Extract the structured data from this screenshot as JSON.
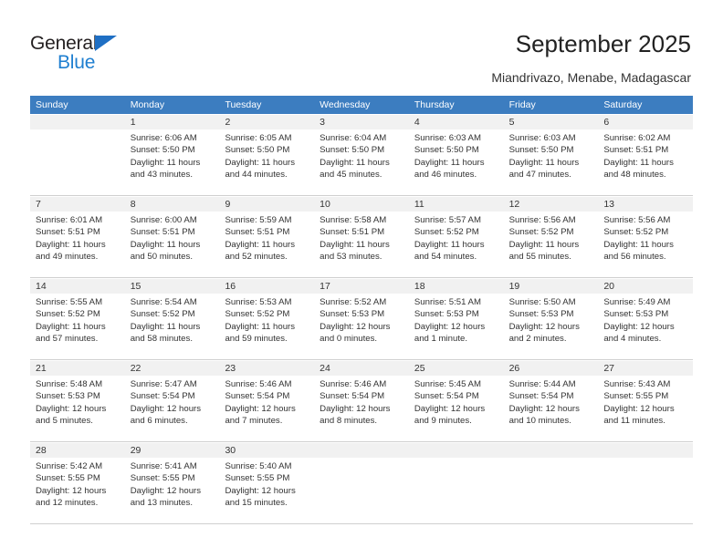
{
  "brand": {
    "name_top": "General",
    "name_bottom": "Blue",
    "triangle_color": "#1f6fc4",
    "blue_text_color": "#1f7fd0"
  },
  "header": {
    "title": "September 2025",
    "subtitle": "Miandrivazo, Menabe, Madagascar"
  },
  "theme": {
    "header_bg": "#3c7dc0",
    "header_text": "#ffffff",
    "datenum_bg": "#f1f1f1",
    "cell_bg": "#ffffff",
    "grid_line": "#cfcfcf",
    "text": "#333333"
  },
  "calendar": {
    "weekdays": [
      "Sunday",
      "Monday",
      "Tuesday",
      "Wednesday",
      "Thursday",
      "Friday",
      "Saturday"
    ],
    "weeks": [
      {
        "days": [
          {
            "num": "",
            "sunrise": "",
            "sunset": "",
            "daylight_1": "",
            "daylight_2": ""
          },
          {
            "num": "1",
            "sunrise": "Sunrise: 6:06 AM",
            "sunset": "Sunset: 5:50 PM",
            "daylight_1": "Daylight: 11 hours",
            "daylight_2": "and 43 minutes."
          },
          {
            "num": "2",
            "sunrise": "Sunrise: 6:05 AM",
            "sunset": "Sunset: 5:50 PM",
            "daylight_1": "Daylight: 11 hours",
            "daylight_2": "and 44 minutes."
          },
          {
            "num": "3",
            "sunrise": "Sunrise: 6:04 AM",
            "sunset": "Sunset: 5:50 PM",
            "daylight_1": "Daylight: 11 hours",
            "daylight_2": "and 45 minutes."
          },
          {
            "num": "4",
            "sunrise": "Sunrise: 6:03 AM",
            "sunset": "Sunset: 5:50 PM",
            "daylight_1": "Daylight: 11 hours",
            "daylight_2": "and 46 minutes."
          },
          {
            "num": "5",
            "sunrise": "Sunrise: 6:03 AM",
            "sunset": "Sunset: 5:50 PM",
            "daylight_1": "Daylight: 11 hours",
            "daylight_2": "and 47 minutes."
          },
          {
            "num": "6",
            "sunrise": "Sunrise: 6:02 AM",
            "sunset": "Sunset: 5:51 PM",
            "daylight_1": "Daylight: 11 hours",
            "daylight_2": "and 48 minutes."
          }
        ]
      },
      {
        "days": [
          {
            "num": "7",
            "sunrise": "Sunrise: 6:01 AM",
            "sunset": "Sunset: 5:51 PM",
            "daylight_1": "Daylight: 11 hours",
            "daylight_2": "and 49 minutes."
          },
          {
            "num": "8",
            "sunrise": "Sunrise: 6:00 AM",
            "sunset": "Sunset: 5:51 PM",
            "daylight_1": "Daylight: 11 hours",
            "daylight_2": "and 50 minutes."
          },
          {
            "num": "9",
            "sunrise": "Sunrise: 5:59 AM",
            "sunset": "Sunset: 5:51 PM",
            "daylight_1": "Daylight: 11 hours",
            "daylight_2": "and 52 minutes."
          },
          {
            "num": "10",
            "sunrise": "Sunrise: 5:58 AM",
            "sunset": "Sunset: 5:51 PM",
            "daylight_1": "Daylight: 11 hours",
            "daylight_2": "and 53 minutes."
          },
          {
            "num": "11",
            "sunrise": "Sunrise: 5:57 AM",
            "sunset": "Sunset: 5:52 PM",
            "daylight_1": "Daylight: 11 hours",
            "daylight_2": "and 54 minutes."
          },
          {
            "num": "12",
            "sunrise": "Sunrise: 5:56 AM",
            "sunset": "Sunset: 5:52 PM",
            "daylight_1": "Daylight: 11 hours",
            "daylight_2": "and 55 minutes."
          },
          {
            "num": "13",
            "sunrise": "Sunrise: 5:56 AM",
            "sunset": "Sunset: 5:52 PM",
            "daylight_1": "Daylight: 11 hours",
            "daylight_2": "and 56 minutes."
          }
        ]
      },
      {
        "days": [
          {
            "num": "14",
            "sunrise": "Sunrise: 5:55 AM",
            "sunset": "Sunset: 5:52 PM",
            "daylight_1": "Daylight: 11 hours",
            "daylight_2": "and 57 minutes."
          },
          {
            "num": "15",
            "sunrise": "Sunrise: 5:54 AM",
            "sunset": "Sunset: 5:52 PM",
            "daylight_1": "Daylight: 11 hours",
            "daylight_2": "and 58 minutes."
          },
          {
            "num": "16",
            "sunrise": "Sunrise: 5:53 AM",
            "sunset": "Sunset: 5:52 PM",
            "daylight_1": "Daylight: 11 hours",
            "daylight_2": "and 59 minutes."
          },
          {
            "num": "17",
            "sunrise": "Sunrise: 5:52 AM",
            "sunset": "Sunset: 5:53 PM",
            "daylight_1": "Daylight: 12 hours",
            "daylight_2": "and 0 minutes."
          },
          {
            "num": "18",
            "sunrise": "Sunrise: 5:51 AM",
            "sunset": "Sunset: 5:53 PM",
            "daylight_1": "Daylight: 12 hours",
            "daylight_2": "and 1 minute."
          },
          {
            "num": "19",
            "sunrise": "Sunrise: 5:50 AM",
            "sunset": "Sunset: 5:53 PM",
            "daylight_1": "Daylight: 12 hours",
            "daylight_2": "and 2 minutes."
          },
          {
            "num": "20",
            "sunrise": "Sunrise: 5:49 AM",
            "sunset": "Sunset: 5:53 PM",
            "daylight_1": "Daylight: 12 hours",
            "daylight_2": "and 4 minutes."
          }
        ]
      },
      {
        "days": [
          {
            "num": "21",
            "sunrise": "Sunrise: 5:48 AM",
            "sunset": "Sunset: 5:53 PM",
            "daylight_1": "Daylight: 12 hours",
            "daylight_2": "and 5 minutes."
          },
          {
            "num": "22",
            "sunrise": "Sunrise: 5:47 AM",
            "sunset": "Sunset: 5:54 PM",
            "daylight_1": "Daylight: 12 hours",
            "daylight_2": "and 6 minutes."
          },
          {
            "num": "23",
            "sunrise": "Sunrise: 5:46 AM",
            "sunset": "Sunset: 5:54 PM",
            "daylight_1": "Daylight: 12 hours",
            "daylight_2": "and 7 minutes."
          },
          {
            "num": "24",
            "sunrise": "Sunrise: 5:46 AM",
            "sunset": "Sunset: 5:54 PM",
            "daylight_1": "Daylight: 12 hours",
            "daylight_2": "and 8 minutes."
          },
          {
            "num": "25",
            "sunrise": "Sunrise: 5:45 AM",
            "sunset": "Sunset: 5:54 PM",
            "daylight_1": "Daylight: 12 hours",
            "daylight_2": "and 9 minutes."
          },
          {
            "num": "26",
            "sunrise": "Sunrise: 5:44 AM",
            "sunset": "Sunset: 5:54 PM",
            "daylight_1": "Daylight: 12 hours",
            "daylight_2": "and 10 minutes."
          },
          {
            "num": "27",
            "sunrise": "Sunrise: 5:43 AM",
            "sunset": "Sunset: 5:55 PM",
            "daylight_1": "Daylight: 12 hours",
            "daylight_2": "and 11 minutes."
          }
        ]
      },
      {
        "days": [
          {
            "num": "28",
            "sunrise": "Sunrise: 5:42 AM",
            "sunset": "Sunset: 5:55 PM",
            "daylight_1": "Daylight: 12 hours",
            "daylight_2": "and 12 minutes."
          },
          {
            "num": "29",
            "sunrise": "Sunrise: 5:41 AM",
            "sunset": "Sunset: 5:55 PM",
            "daylight_1": "Daylight: 12 hours",
            "daylight_2": "and 13 minutes."
          },
          {
            "num": "30",
            "sunrise": "Sunrise: 5:40 AM",
            "sunset": "Sunset: 5:55 PM",
            "daylight_1": "Daylight: 12 hours",
            "daylight_2": "and 15 minutes."
          },
          {
            "num": "",
            "sunrise": "",
            "sunset": "",
            "daylight_1": "",
            "daylight_2": ""
          },
          {
            "num": "",
            "sunrise": "",
            "sunset": "",
            "daylight_1": "",
            "daylight_2": ""
          },
          {
            "num": "",
            "sunrise": "",
            "sunset": "",
            "daylight_1": "",
            "daylight_2": ""
          },
          {
            "num": "",
            "sunrise": "",
            "sunset": "",
            "daylight_1": "",
            "daylight_2": ""
          }
        ]
      }
    ]
  }
}
